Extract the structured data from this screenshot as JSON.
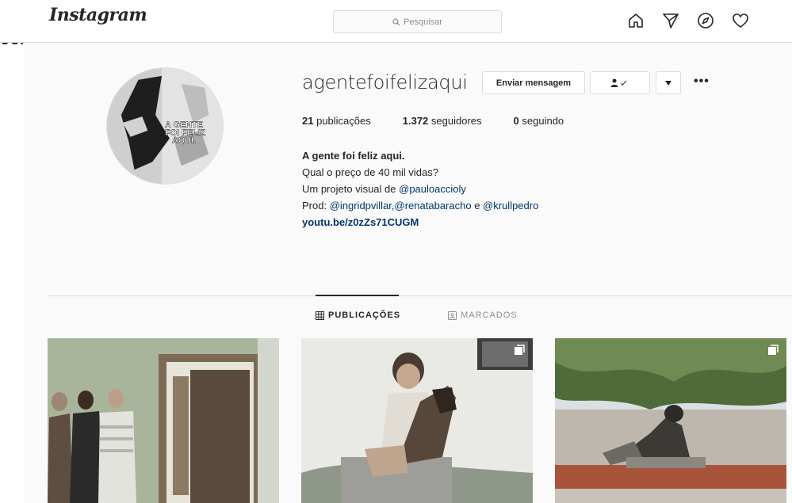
{
  "prefix": "06.",
  "header": {
    "logo": "Instagram",
    "search_placeholder": "Pesquisar",
    "icons": [
      "home-icon",
      "direct-icon",
      "explore-icon",
      "activity-icon"
    ]
  },
  "profile": {
    "username": "agentefoifelizaqui",
    "avatar_text": "A GENTE FOI FELIZ AQUI.",
    "buttons": {
      "message": "Enviar mensagem",
      "follow_icon": "person-check-icon",
      "dropdown_icon": "chevron-down-icon",
      "more": "•••"
    },
    "stats": {
      "posts_count": "21",
      "posts_label": "publicações",
      "followers_count": "1.372",
      "followers_label": "seguidores",
      "following_count": "0",
      "following_label": "seguindo"
    },
    "bio": {
      "name": "A gente foi feliz aqui.",
      "line1": "Qual o preço de 40 mil vidas?",
      "line2_prefix": "Um projeto visual de ",
      "line2_mention": "@pauloaccioly",
      "line3_prefix": "Prod: ",
      "line3_mentions": "@ingridpvillar,@renatabaracho",
      "line3_mid": " e ",
      "line3_last": "@krullpedro",
      "link": "youtu.be/z0zZs71CUGM"
    }
  },
  "tabs": [
    {
      "label": "PUBLICAÇÕES",
      "icon": "grid-icon",
      "active": true
    },
    {
      "label": "MARCADOS",
      "icon": "tagged-icon",
      "active": false
    }
  ],
  "posts": [
    {
      "desc": "family-photo",
      "multi": false
    },
    {
      "desc": "boy-with-dog",
      "multi": true
    },
    {
      "desc": "statue-under-tree",
      "multi": true
    }
  ],
  "colors": {
    "border": "#dbdbdb",
    "background": "#fafafa",
    "link": "#00376b",
    "muted": "#8e8e8e"
  }
}
